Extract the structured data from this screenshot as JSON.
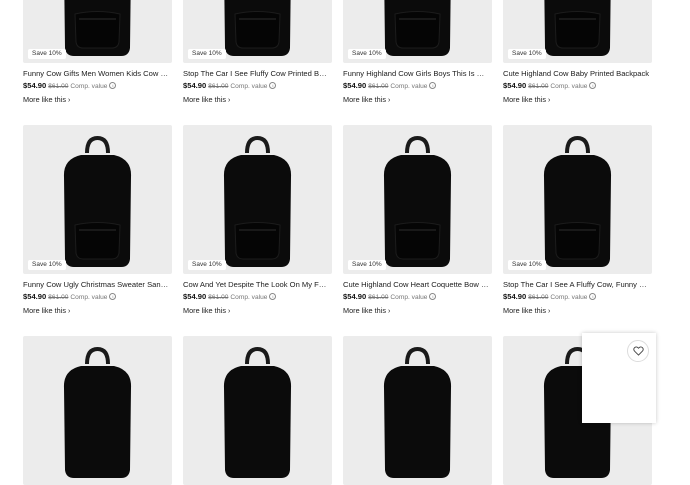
{
  "products": [
    {
      "title": "Funny Cow Gifts Men Women Kids Cow Printed Backpack",
      "badge": "Save 10%",
      "price": "$54.90",
      "original_price": "$61.00",
      "comp_label": "Comp. value",
      "more_label": "More like this"
    },
    {
      "title": "Stop The Car I See Fluffy Cow Printed Backpack",
      "badge": "Save 10%",
      "price": "$54.90",
      "original_price": "$61.00",
      "comp_label": "Comp. value",
      "more_label": "More like this"
    },
    {
      "title": "Funny Highland Cow Girls Boys This Is My Backpack",
      "badge": "Save 10%",
      "price": "$54.90",
      "original_price": "$61.00",
      "comp_label": "Comp. value",
      "more_label": "More like this"
    },
    {
      "title": "Cute Highland Cow Baby Printed Backpack",
      "badge": "Save 10%",
      "price": "$54.90",
      "original_price": "$61.00",
      "comp_label": "Comp. value",
      "more_label": "More like this"
    },
    {
      "title": "Funny Cow Ugly Christmas Sweater Santa Backpack",
      "badge": "Save 10%",
      "price": "$54.90",
      "original_price": "$61.00",
      "comp_label": "Comp. value",
      "more_label": "More like this"
    },
    {
      "title": "Cow And Yet Despite The Look On My Face Backpack",
      "badge": "Save 10%",
      "price": "$54.90",
      "original_price": "$61.00",
      "comp_label": "Comp. value",
      "more_label": "More like this"
    },
    {
      "title": "Cute Highland Cow Heart Coquette Bow Backpack",
      "badge": "Save 10%",
      "price": "$54.90",
      "original_price": "$61.00",
      "comp_label": "Comp. value",
      "more_label": "More like this"
    },
    {
      "title": "Stop The Car I See A Fluffy Cow, Funny Backpack",
      "badge": "Save 10%",
      "price": "$54.90",
      "original_price": "$61.00",
      "comp_label": "Comp. value",
      "more_label": "More like this"
    },
    {
      "title": "",
      "badge": "",
      "price": "",
      "original_price": "",
      "comp_label": "",
      "more_label": ""
    },
    {
      "title": "",
      "badge": "",
      "price": "",
      "original_price": "",
      "comp_label": "",
      "more_label": ""
    },
    {
      "title": "",
      "badge": "",
      "price": "",
      "original_price": "",
      "comp_label": "",
      "more_label": ""
    },
    {
      "title": "",
      "badge": "",
      "price": "",
      "original_price": "",
      "comp_label": "",
      "more_label": ""
    }
  ],
  "icons": {
    "info": "info-circle-icon",
    "chevron": "chevron-right-icon",
    "wishlist": "heart-outline-icon"
  },
  "colors": {
    "thumb_bg": "#ececec",
    "backpack": "#0b0b0b",
    "badge_bg": "#ffffff",
    "strike_text": "#757575"
  }
}
